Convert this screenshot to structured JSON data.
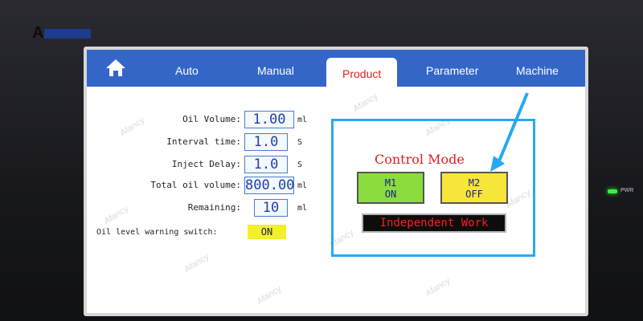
{
  "brand": {
    "logo_text": "A"
  },
  "indicator": {
    "power_label": "PWR"
  },
  "tabs": [
    {
      "label": "Auto"
    },
    {
      "label": "Manual"
    },
    {
      "label": "Product",
      "active": true
    },
    {
      "label": "Parameter"
    },
    {
      "label": "Machine"
    }
  ],
  "fields": {
    "oil_volume": {
      "label": "Oil Volume:",
      "value": "1.00",
      "unit": "ml"
    },
    "interval_time": {
      "label": "Interval time:",
      "value": "1.0",
      "unit": "S"
    },
    "inject_delay": {
      "label": "Inject Delay:",
      "value": "1.0",
      "unit": "S"
    },
    "total_oil_volume": {
      "label": "Total oil volume:",
      "value": "800.00",
      "unit": "ml"
    },
    "remaining": {
      "label": "Remaining:",
      "value": "10",
      "unit": "ml"
    }
  },
  "oil_warning": {
    "label": "Oil level warning switch:",
    "value": "ON"
  },
  "control_mode": {
    "title": "Control Mode",
    "m1": {
      "name": "M1",
      "state": "ON"
    },
    "m2": {
      "name": "M2",
      "state": "OFF"
    },
    "status": "Independent Work"
  },
  "watermark": {
    "text": "Afancy"
  },
  "colors": {
    "tab_bar": "#3466c8",
    "active_tab_text": "#e22020",
    "m1_bg": "#8bdc3d",
    "m2_bg": "#f7e63a",
    "switch_bg": "#f2f029",
    "highlight_frame": "#27a9f2"
  }
}
